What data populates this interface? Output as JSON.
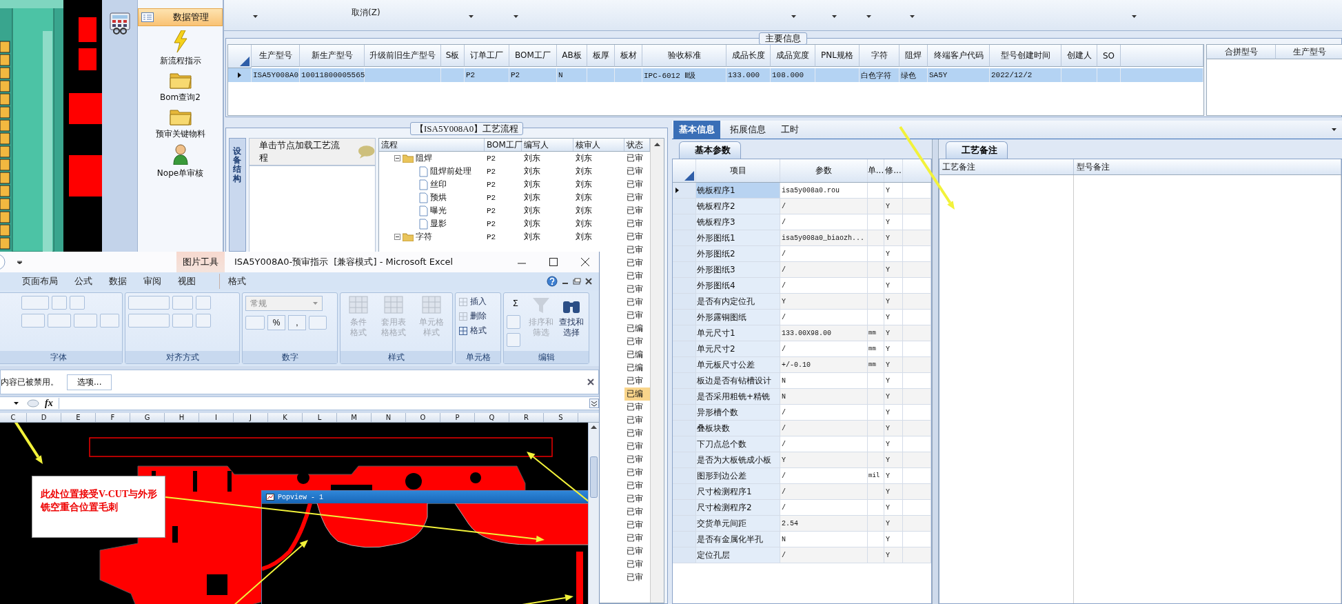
{
  "toolbar": {
    "buttons": [
      {
        "label": "取消(Z)"
      }
    ]
  },
  "nav": {
    "sections": [
      {
        "label": "数据管理",
        "selected": true
      }
    ],
    "tools": [
      {
        "label": "新流程指示",
        "kind": "lightning"
      },
      {
        "label": "Bom查询2",
        "kind": "folder"
      },
      {
        "label": "预审关键物料",
        "kind": "folder"
      },
      {
        "label": "Nope单审核",
        "kind": "person"
      }
    ]
  },
  "main_info": {
    "title": "主要信息",
    "columns": [
      "生产型号",
      "新生产型号",
      "升级前旧生产型号",
      "S板",
      "订单工厂",
      "BOM工厂",
      "AB板",
      "板厚",
      "板材",
      "验收标准",
      "成品长度",
      "成品宽度",
      "PNL规格",
      "字符",
      "阻焊",
      "终端客户代码",
      "型号创建时间",
      "创建人",
      "SO"
    ],
    "rows": [
      {
        "selected": true,
        "cells": [
          "ISA5Y008A0",
          "10011800005565",
          null,
          null,
          "P2",
          "P2",
          "N",
          null,
          null,
          "IPC-6012 Ⅱ级",
          "133.000",
          "108.000",
          null,
          "白色字符",
          "绿色",
          "SA5Y",
          "2022/12/2",
          null,
          null
        ]
      }
    ],
    "merge_table": {
      "columns": [
        "合拼型号",
        "生产型号"
      ]
    }
  },
  "process_flow": {
    "title": "【ISA5Y008A0】工艺流程",
    "side_tab": "设备结构",
    "hint": "单击节点加载工艺流程",
    "columns": [
      "流程",
      "BOM工厂",
      "编写人",
      "核审人",
      "状态"
    ],
    "tree": [
      {
        "name": "阻焊",
        "kind": "folder",
        "expanded": true,
        "bom_factory": "P2",
        "author": "刘东",
        "reviewer": "刘东",
        "status": "已审",
        "selected": false,
        "children": [
          {
            "name": "阻焊前处理",
            "kind": "step",
            "bom_factory": "P2",
            "author": "刘东",
            "reviewer": "刘东",
            "status": "已审",
            "selected": false
          },
          {
            "name": "丝印",
            "kind": "step",
            "bom_factory": "P2",
            "author": "刘东",
            "reviewer": "刘东",
            "status": "已审",
            "selected": false
          },
          {
            "name": "预烘",
            "kind": "step",
            "bom_factory": "P2",
            "author": "刘东",
            "reviewer": "刘东",
            "status": "已审",
            "selected": false
          },
          {
            "name": "曝光",
            "kind": "step",
            "bom_factory": "P2",
            "author": "刘东",
            "reviewer": "刘东",
            "status": "已审",
            "selected": false
          },
          {
            "name": "显影",
            "kind": "step",
            "bom_factory": "P2",
            "author": "刘东",
            "reviewer": "刘东",
            "status": "已审",
            "selected": false
          }
        ]
      },
      {
        "name": "字符",
        "kind": "folder",
        "expanded": true,
        "bom_factory": "P2",
        "author": "刘东",
        "reviewer": "刘东",
        "status": "已审",
        "selected": false
      }
    ],
    "more_rows": [
      {
        "status": "已审",
        "selected": false
      },
      {
        "status": "已审",
        "selected": false
      },
      {
        "status": "已审",
        "selected": false
      },
      {
        "status": "已审",
        "selected": false
      },
      {
        "status": "已审",
        "selected": false
      },
      {
        "status": "已审",
        "selected": false
      },
      {
        "status": "已编",
        "selected": false
      },
      {
        "status": "已审",
        "selected": false
      },
      {
        "status": "已编",
        "selected": false
      },
      {
        "status": "已编",
        "selected": false
      },
      {
        "status": "已审",
        "selected": false
      },
      {
        "status": "已编",
        "selected": true
      },
      {
        "status": "已审",
        "selected": false
      },
      {
        "status": "已审",
        "selected": false
      },
      {
        "status": "已审",
        "selected": false
      },
      {
        "status": "已审",
        "selected": false
      },
      {
        "status": "已审",
        "selected": false
      },
      {
        "status": "已审",
        "selected": false
      },
      {
        "status": "已审",
        "selected": false
      },
      {
        "status": "已审",
        "selected": false
      },
      {
        "status": "已审",
        "selected": false
      },
      {
        "status": "已审",
        "selected": false
      },
      {
        "status": "已审",
        "selected": false
      },
      {
        "status": "已审",
        "selected": false
      },
      {
        "status": "已审",
        "selected": false
      },
      {
        "status": "已审",
        "selected": false
      }
    ]
  },
  "params": {
    "tabs": [
      {
        "label": "基本信息",
        "selected": true
      },
      {
        "label": "拓展信息",
        "selected": false
      },
      {
        "label": "工时",
        "selected": false
      }
    ],
    "subtab": "基本参数",
    "columns": [
      "项目",
      "参数",
      "单...",
      "修..."
    ],
    "rows": [
      {
        "item": "铣板程序1",
        "value": "isa5y008a0.rou",
        "modifiable": "Y",
        "selected": true
      },
      {
        "item": "铣板程序2",
        "value": "/",
        "modifiable": "Y",
        "selected": false
      },
      {
        "item": "铣板程序3",
        "value": "/",
        "modifiable": "Y",
        "selected": false
      },
      {
        "item": "外形图纸1",
        "value": "isa5y008a0_biaozh...",
        "modifiable": "Y",
        "selected": false
      },
      {
        "item": "外形图纸2",
        "value": "/",
        "modifiable": "Y",
        "selected": false
      },
      {
        "item": "外形图纸3",
        "value": "/",
        "modifiable": "Y",
        "selected": false
      },
      {
        "item": "外形图纸4",
        "value": "/",
        "modifiable": "Y",
        "selected": false
      },
      {
        "item": "是否有内定位孔",
        "value": "Y",
        "modifiable": "Y",
        "selected": false
      },
      {
        "item": "外形露铜图纸",
        "value": "/",
        "modifiable": "Y",
        "selected": false
      },
      {
        "item": "单元尺寸1",
        "value": "133.00X98.00",
        "unit": "mm",
        "modifiable": "Y",
        "selected": false
      },
      {
        "item": "单元尺寸2",
        "value": "/",
        "unit": "mm",
        "modifiable": "Y",
        "selected": false
      },
      {
        "item": "单元板尺寸公差",
        "value": "+/-0.10",
        "unit": "mm",
        "modifiable": "Y",
        "selected": false
      },
      {
        "item": "板边是否有钻槽设计",
        "value": "N",
        "modifiable": "Y",
        "selected": false
      },
      {
        "item": "是否采用粗铣+精铣",
        "value": "N",
        "modifiable": "Y",
        "selected": false
      },
      {
        "item": "异形槽个数",
        "value": "/",
        "modifiable": "Y",
        "selected": false
      },
      {
        "item": "叠板块数",
        "value": "/",
        "modifiable": "Y",
        "selected": false
      },
      {
        "item": "下刀点总个数",
        "value": "/",
        "modifiable": "Y",
        "selected": false
      },
      {
        "item": "是否为大板铣成小板",
        "value": "Y",
        "modifiable": "Y",
        "selected": false
      },
      {
        "item": "图形到边公差",
        "value": "/",
        "unit": "mil",
        "modifiable": "Y",
        "selected": false
      },
      {
        "item": "尺寸检测程序1",
        "value": "/",
        "modifiable": "Y",
        "selected": false
      },
      {
        "item": "尺寸检测程序2",
        "value": "/",
        "modifiable": "Y",
        "selected": false
      },
      {
        "item": "交货单元间距",
        "value": "2.54",
        "modifiable": "Y",
        "selected": false
      },
      {
        "item": "是否有金属化半孔",
        "value": "N",
        "modifiable": "Y",
        "selected": false
      },
      {
        "item": "定位孔层",
        "value": "/",
        "modifiable": "Y",
        "selected": false
      }
    ]
  },
  "notes": {
    "tab": "工艺备注",
    "columns": [
      "工艺备注",
      "型号备注"
    ]
  },
  "excel": {
    "context_tab": "图片工具",
    "title": "ISA5Y008A0-预审指示  [兼容模式] - Microsoft Excel",
    "ribbon_tabs": [
      {
        "label": "页面布局",
        "selected": false
      },
      {
        "label": "公式",
        "selected": false
      },
      {
        "label": "数据",
        "selected": false
      },
      {
        "label": "审阅",
        "selected": false
      },
      {
        "label": "视图",
        "selected": false
      },
      {
        "label": "格式",
        "selected": false
      }
    ],
    "groups": [
      {
        "label": "字体",
        "kind": "font"
      },
      {
        "label": "对齐方式",
        "kind": "align"
      },
      {
        "label": "数字",
        "kind": "number",
        "format": "常规",
        "symbols": [
          "%",
          ","
        ]
      },
      {
        "label": "样式",
        "kind": "styles",
        "buttons": [
          {
            "label": "条件格式",
            "disabled": true
          },
          {
            "label": "套用表格格式",
            "disabled": true
          },
          {
            "label": "单元格样式",
            "disabled": true
          }
        ]
      },
      {
        "label": "单元格",
        "kind": "cells",
        "buttons": [
          {
            "label": "插入",
            "disabled": true
          },
          {
            "label": "删除",
            "disabled": true
          },
          {
            "label": "格式",
            "disabled": false
          }
        ]
      },
      {
        "label": "编辑",
        "kind": "editing",
        "symbol": "Σ",
        "buttons": [
          {
            "label": "排序和筛选",
            "disabled": true
          },
          {
            "label": "查找和选择",
            "disabled": false
          }
        ]
      }
    ],
    "message": "内容已被禁用。",
    "options_button": "选项...",
    "formula_label": "fx",
    "columns": [
      "C",
      "D",
      "E",
      "F",
      "G",
      "H",
      "I",
      "J",
      "K",
      "L",
      "M",
      "N",
      "O",
      "P",
      "Q",
      "R",
      "S"
    ],
    "callout": "此处位置接受V-CUT与外形铣空重合位置毛刺",
    "popview_title": "Popview - 1"
  }
}
